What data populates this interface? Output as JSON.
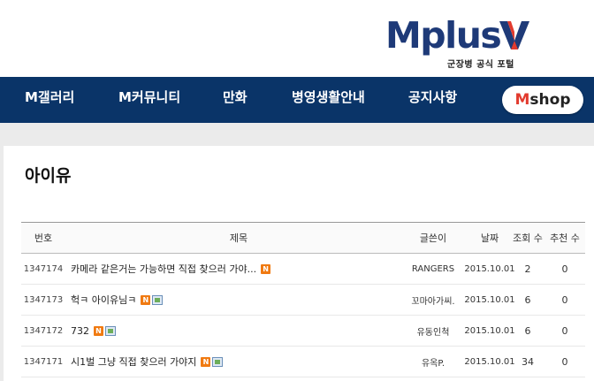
{
  "header": {
    "logo_text": "Mplus",
    "logo_v": "V",
    "logo_subtitle": "군장병 공식 포털"
  },
  "nav": {
    "items": [
      {
        "label": "M갤러리"
      },
      {
        "label": "M커뮤니티"
      },
      {
        "label": "만화"
      },
      {
        "label": "병영생활안내"
      },
      {
        "label": "공지사항"
      }
    ],
    "shop": {
      "m": "M",
      "rest": "shop"
    }
  },
  "board": {
    "title": "아이유",
    "columns": {
      "no": "번호",
      "title": "제목",
      "writer": "글쓴이",
      "date": "날짜",
      "views": "조회 수",
      "recommend": "추천 수"
    },
    "badge_new": "N",
    "rows": [
      {
        "no": "1347174",
        "title": "카메라 같은거는 가능하면 직접 찾으러 가야...",
        "writer": "RANGERS",
        "date": "2015.10.01",
        "views": "2",
        "recommend": "0",
        "new": true,
        "image": false
      },
      {
        "no": "1347173",
        "title": "헉ㅋ 아이유님ㅋ",
        "writer": "꼬마아가씨.",
        "date": "2015.10.01",
        "views": "6",
        "recommend": "0",
        "new": true,
        "image": true
      },
      {
        "no": "1347172",
        "title": "732",
        "writer": "유동인척",
        "date": "2015.10.01",
        "views": "6",
        "recommend": "0",
        "new": true,
        "image": true
      },
      {
        "no": "1347171",
        "title": "시1벌 그냥 직접 찾으러 가야지",
        "writer": "유옥P.",
        "date": "2015.10.01",
        "views": "34",
        "recommend": "0",
        "new": true,
        "image": true
      }
    ]
  },
  "colors": {
    "nav_bg": "#0a3468",
    "logo_blue": "#1e3a78",
    "accent_red": "#e23b2e",
    "new_badge": "#f07a11"
  }
}
